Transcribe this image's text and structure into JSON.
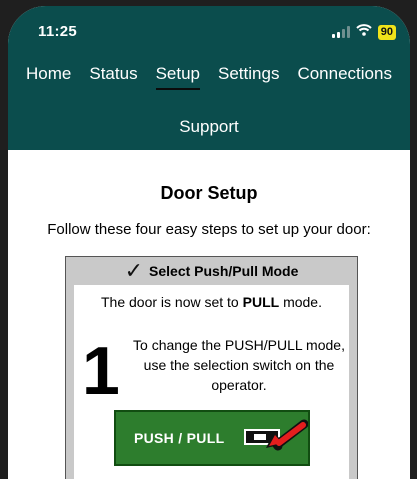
{
  "status_bar": {
    "time": "11:25",
    "battery": "90",
    "icons": [
      "signal-icon",
      "wifi-icon",
      "battery-icon"
    ]
  },
  "nav": {
    "tabs": [
      {
        "label": "Home",
        "active": false
      },
      {
        "label": "Status",
        "active": false
      },
      {
        "label": "Setup",
        "active": true
      },
      {
        "label": "Settings",
        "active": false
      },
      {
        "label": "Connections",
        "active": false
      }
    ],
    "second_row": "Support"
  },
  "page": {
    "title": "Door Setup",
    "intro": "Follow these four easy steps to set up your door:"
  },
  "step_card": {
    "header": "Select Push/Pull Mode",
    "mode_prefix": "The door is now set to ",
    "mode_value": "PULL",
    "mode_suffix": " mode.",
    "step_number": "1",
    "instruction": "To change the PUSH/PULL mode, use the selection switch on the operator.",
    "switch_label": "PUSH / PULL"
  },
  "colors": {
    "header_bg": "#0b4d4d",
    "panel_green": "#2d7d2d",
    "arrow_red": "#e41e1e",
    "battery_yellow": "#f0e31a"
  }
}
